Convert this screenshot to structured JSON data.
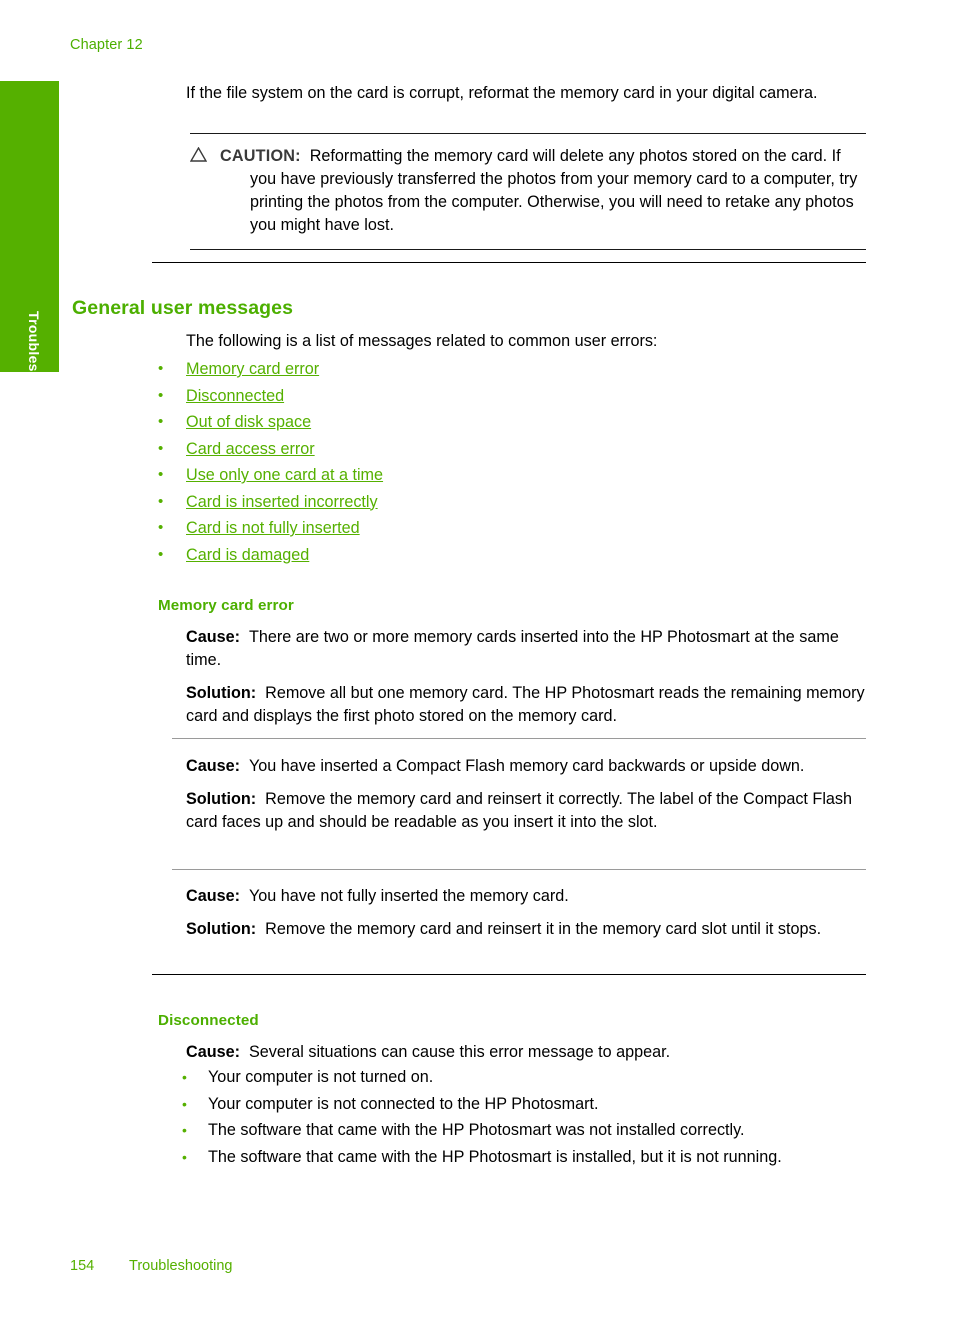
{
  "page": {
    "chapter_label": "Chapter 12",
    "side_tab_label": "Troubleshooting",
    "footer_page_number": "154",
    "footer_section": "Troubleshooting",
    "accent_green": "#55B000",
    "heading_green": "#4CAF00"
  },
  "intro": {
    "paragraph": "If the file system on the card is corrupt, reformat the memory card in your digital camera."
  },
  "caution": {
    "icon": "warning-triangle-icon",
    "label": "CAUTION:",
    "text": "Reformatting the memory card will delete any photos stored on the card. If you have previously transferred the photos from your memory card to a computer, try printing the photos from the computer. Otherwise, you will need to retake any photos you might have lost."
  },
  "general_user_messages": {
    "heading": "General user messages",
    "intro": "The following is a list of messages related to common user errors:",
    "links": [
      "Memory card error",
      "Disconnected",
      "Out of disk space",
      "Card access error",
      "Use only one card at a time",
      "Card is inserted incorrectly",
      "Card is not fully inserted",
      "Card is damaged"
    ]
  },
  "memory_card_error": {
    "heading": "Memory card error",
    "cause_label": "Cause:",
    "solution_label": "Solution:",
    "entries": [
      {
        "cause": "There are two or more memory cards inserted into the HP Photosmart at the same time.",
        "solution": "Remove all but one memory card. The HP Photosmart reads the remaining memory card and displays the first photo stored on the memory card."
      },
      {
        "cause": "You have inserted a Compact Flash memory card backwards or upside down.",
        "solution": "Remove the memory card and reinsert it correctly. The label of the Compact Flash card faces up and should be readable as you insert it into the slot."
      },
      {
        "cause": "You have not fully inserted the memory card.",
        "solution": "Remove the memory card and reinsert it in the memory card slot until it stops."
      }
    ]
  },
  "disconnected": {
    "heading": "Disconnected",
    "cause_label": "Cause:",
    "cause": "Several situations can cause this error message to appear.",
    "bullets": [
      "Your computer is not turned on.",
      "Your computer is not connected to the HP Photosmart.",
      "The software that came with the HP Photosmart was not installed correctly.",
      "The software that came with the HP Photosmart is installed, but it is not running."
    ]
  }
}
